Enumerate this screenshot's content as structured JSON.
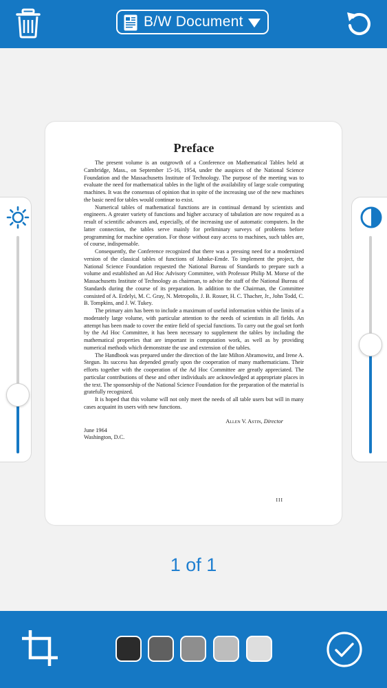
{
  "toolbar": {
    "mode_label": "B/W Document",
    "icons": [
      "trash-icon",
      "document-icon",
      "caret-down-icon",
      "undo-icon"
    ]
  },
  "sliders": {
    "brightness": {
      "icon": "sun-icon",
      "value": 0.27
    },
    "contrast": {
      "icon": "contrast-icon",
      "value": 0.5
    }
  },
  "document": {
    "title": "Preface",
    "paragraphs": [
      "The present volume is an outgrowth of a Conference on Mathematical Tables held at Cambridge, Mass., on September 15-16, 1954, under the auspices of the National Science Foundation and the Massachusetts Institute of Technology. The purpose of the meeting was to evaluate the need for mathematical tables in the light of the availability of large scale computing machines. It was the consensus of opinion that in spite of the increasing use of the new machines the basic need for tables would continue to exist.",
      "Numerical tables of mathematical functions are in continual demand by scientists and engineers. A greater variety of functions and higher accuracy of tabulation are now required as a result of scientific advances and, especially, of the increasing use of automatic computers. In the latter connection, the tables serve mainly for preliminary surveys of problems before programming for machine operation. For those without easy access to machines, such tables are, of course, indispensable.",
      "Consequently, the Conference recognized that there was a pressing need for a modernized version of the classical tables of functions of Jahnke-Emde. To implement the project, the National Science Foundation requested the National Bureau of Standards to prepare such a volume and established an Ad Hoc Advisory Committee, with Professor Philip M. Morse of the Massachusetts Institute of Technology as chairman, to advise the staff of the National Bureau of Standards during the course of its preparation. In addition to the Chairman, the Committee consisted of A. Erdelyi, M. C. Gray, N. Metropolis, J. B. Rosser, H. C. Thacher, Jr., John Todd, C. B. Tompkins, and J. W. Tukey.",
      "The primary aim has been to include a maximum of useful information within the limits of a moderately large volume, with particular attention to the needs of scientists in all fields. An attempt has been made to cover the entire field of special functions. To carry out the goal set forth by the Ad Hoc Committee, it has been necessary to supplement the tables by including the mathematical properties that are important in computation work, as well as by providing numerical methods which demonstrate the use and extension of the tables.",
      "The Handbook was prepared under the direction of the late Milton Abramowitz, and Irene A. Stegun. Its success has depended greatly upon the cooperation of many mathematicians. Their efforts together with the cooperation of the Ad Hoc Committee are greatly appreciated. The particular contributions of these and other individuals are acknowledged at appropriate places in the text. The sponsorship of the National Science Foundation for the preparation of the material is gratefully recognized.",
      "It is hoped that this volume will not only meet the needs of all table users but will in many cases acquaint its users with new functions."
    ],
    "signature_name": "Allen V. Astin,",
    "signature_title": "Director",
    "date": "June 1964",
    "place": "Washington, D.C.",
    "page_number": "III"
  },
  "page_counter": "1 of 1",
  "bottom": {
    "icons": [
      "crop-icon",
      "checkmark-icon"
    ],
    "swatches": [
      {
        "name": "darkest",
        "color": "#2b2b2b"
      },
      {
        "name": "dark",
        "color": "#606060"
      },
      {
        "name": "medium",
        "color": "#8e8e8e"
      },
      {
        "name": "light",
        "color": "#bdbdbd"
      },
      {
        "name": "lightest",
        "color": "#dedede"
      }
    ]
  },
  "colors": {
    "accent": "#1578c4",
    "counter_text": "#1f7fd0",
    "background": "#f2f2f2"
  }
}
